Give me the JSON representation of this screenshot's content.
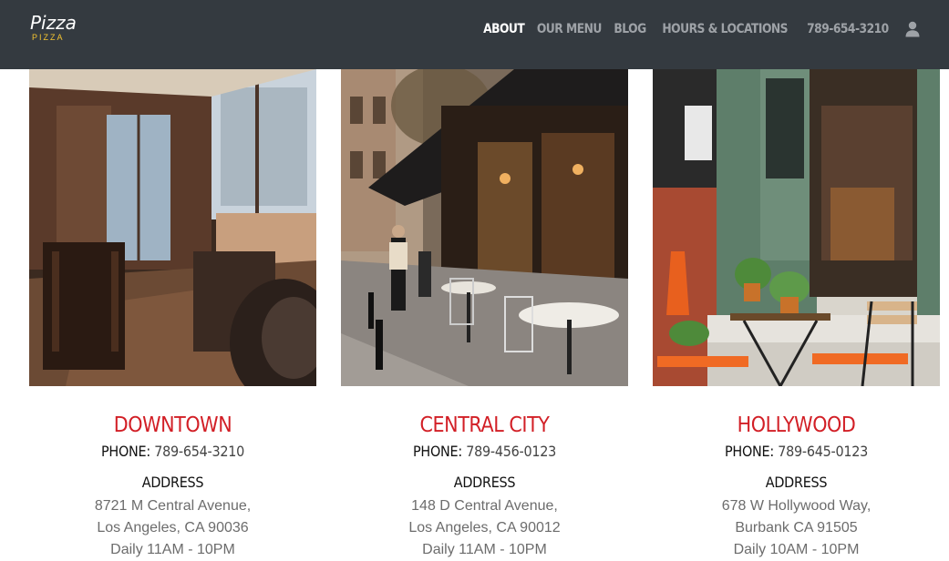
{
  "header": {
    "logo_main": "Pizza",
    "logo_sub": "PIZZA",
    "nav": [
      {
        "label": "ABOUT",
        "active": true
      },
      {
        "label": "OUR MENU",
        "active": false
      },
      {
        "label": "BLOG",
        "active": false
      },
      {
        "label": "HOURS & LOCATIONS",
        "active": false
      },
      {
        "label": "789-654-3210",
        "active": false
      }
    ],
    "user_icon": "user-icon"
  },
  "colors": {
    "header_bg": "#343a40",
    "accent_red": "#d21f26",
    "logo_yellow": "#f4c430",
    "nav_inactive": "#9ea2a7",
    "nav_active": "#ffffff"
  },
  "locations": [
    {
      "name": "DOWNTOWN",
      "phone_label": "PHONE:",
      "phone": "789-654-3210",
      "address_heading": "ADDRESS",
      "address_line1": "8721 M Central Avenue,",
      "address_line2": "Los Angeles, CA 90036",
      "hours": "Daily 11AM - 10PM"
    },
    {
      "name": "CENTRAL CITY",
      "phone_label": "PHONE:",
      "phone": "789-456-0123",
      "address_heading": "ADDRESS",
      "address_line1": "148 D Central Avenue,",
      "address_line2": "Los Angeles, CA 90012",
      "hours": "Daily 11AM - 10PM"
    },
    {
      "name": "HOLLYWOOD",
      "phone_label": "PHONE:",
      "phone": "789-645-0123",
      "address_heading": "ADDRESS",
      "address_line1": "678 W Hollywood Way,",
      "address_line2": "Burbank CA 91505",
      "hours": "Daily 10AM - 10PM"
    }
  ]
}
